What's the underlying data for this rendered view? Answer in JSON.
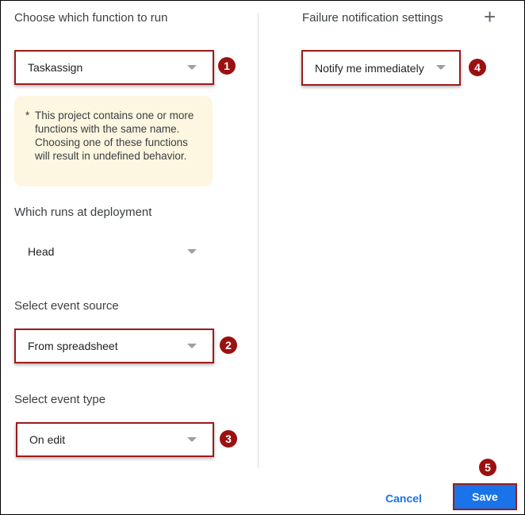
{
  "function": {
    "label": "Choose which function to run",
    "value": "Taskassign",
    "badge": "1"
  },
  "warning": {
    "star": "*",
    "text": "This project contains one or more functions with the same name. Choosing one of these functions will result in undefined behavior."
  },
  "deployment": {
    "label": "Which runs at deployment",
    "value": "Head"
  },
  "event_source": {
    "label": "Select event source",
    "value": "From spreadsheet",
    "badge": "2"
  },
  "event_type": {
    "label": "Select event type",
    "value": "On edit",
    "badge": "3"
  },
  "failure": {
    "label": "Failure notification settings",
    "add": "+",
    "value": "Notify me immediately",
    "badge": "4"
  },
  "footer": {
    "cancel": "Cancel",
    "save": "Save",
    "badge": "5"
  }
}
